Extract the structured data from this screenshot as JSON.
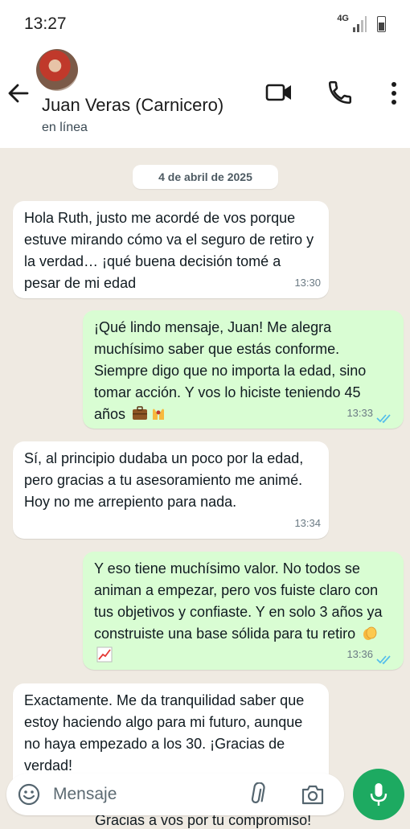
{
  "status_bar": {
    "time": "13:27",
    "network": "4G"
  },
  "header": {
    "contact_name": "Juan Veras (Carnicero)",
    "contact_status": "en línea",
    "icons": [
      "back-arrow-icon",
      "video-call-icon",
      "phone-icon",
      "more-vert-icon"
    ]
  },
  "chat": {
    "date_label": "4 de abril de 2025",
    "messages": [
      {
        "direction": "in",
        "text": "Hola Ruth, justo me acordé de vos porque estuve mirando cómo va el seguro de retiro y la verdad… ¡qué buena decisión tomé a pesar de mi edad",
        "time": "13:30"
      },
      {
        "direction": "out",
        "text": "¡Qué lindo mensaje, Juan! Me alegra muchísimo saber que estás conforme. Siempre digo que no importa la edad, sino tomar acción. Y vos lo hiciste teniendo 45 años",
        "emojis": [
          "briefcase-emoji",
          "raising-hands-emoji"
        ],
        "time": "13:33",
        "read": true
      },
      {
        "direction": "in",
        "text": "Sí, al principio dudaba un poco por la edad, pero gracias a tu asesoramiento me animé. Hoy no me arrepiento para nada.",
        "time": "13:34"
      },
      {
        "direction": "out",
        "text": "Y eso tiene muchísimo valor. No todos se animan a empezar, pero vos fuiste claro con tus objetivos y confiaste. Y en solo 3 años ya construiste una base sólida para tu retiro",
        "emojis": [
          "clapping-hands-emoji",
          "chart-increasing-emoji"
        ],
        "time": "13:36",
        "read": true
      },
      {
        "direction": "in",
        "text": "Exactamente. Me da tranquilidad saber que estoy haciendo algo para mi futuro, aunque no haya empezado a los 30. ¡Gracias de verdad!",
        "time": ""
      }
    ],
    "partial_next": "Gracias a vos por tu compromiso!"
  },
  "input_bar": {
    "placeholder": "Mensaje",
    "icons": [
      "emoji-icon",
      "attach-icon",
      "camera-icon",
      "mic-icon"
    ]
  },
  "colors": {
    "accent": "#1daa61",
    "outgoing_bubble": "#d9fdd3",
    "incoming_bubble": "#ffffff",
    "chat_bg": "#efeae2",
    "read_ticks": "#53bdeb"
  }
}
